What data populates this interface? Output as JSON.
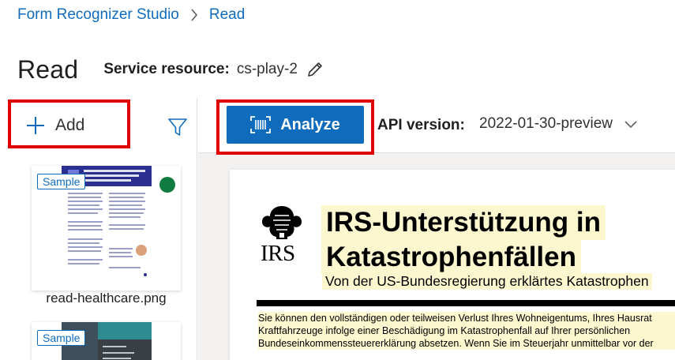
{
  "breadcrumb": {
    "root": "Form Recognizer Studio",
    "current": "Read"
  },
  "header": {
    "title": "Read",
    "service_label": "Service resource:",
    "service_value": "cs-play-2"
  },
  "left_pane": {
    "add_label": "Add",
    "items": [
      {
        "badge": "Sample",
        "name": "read-healthcare.png",
        "status_color": "#107c41"
      },
      {
        "badge": "Sample",
        "name": ""
      }
    ]
  },
  "toolbar": {
    "analyze_label": "Analyze",
    "api_label": "API version:",
    "api_value": "2022-01-30-preview"
  },
  "document": {
    "logo_text": "IRS",
    "title_line1": "IRS-Unterstützung in",
    "title_line2": "Katastrophenfällen",
    "subtitle": "Von der US-Bundesregierung erklärtes Katastrophen",
    "para_line1": "Sie können den vollständigen oder teilweisen Verlust Ihres Wohneigentums, Ihres Hausrat",
    "para_line2": "Kraftfahrzeuge infolge einer Beschädigung im Katastrophenfall auf Ihrer persönlichen",
    "para_line3": "Bundeseinkommenssteuererklärung absetzen. Wenn Sie im  Steuerjahr unmittelbar vor der"
  },
  "colors": {
    "accent": "#0f6cbd",
    "highlight_box": "#e00000",
    "status_dot": "#107c41",
    "text_highlight": "#fdf7d0"
  },
  "icons": {
    "separator": "chevron-right-icon",
    "edit": "pencil-icon",
    "add": "plus-icon",
    "filter": "filter-icon",
    "analyze": "scan-icon",
    "dropdown": "chevron-down-icon"
  }
}
